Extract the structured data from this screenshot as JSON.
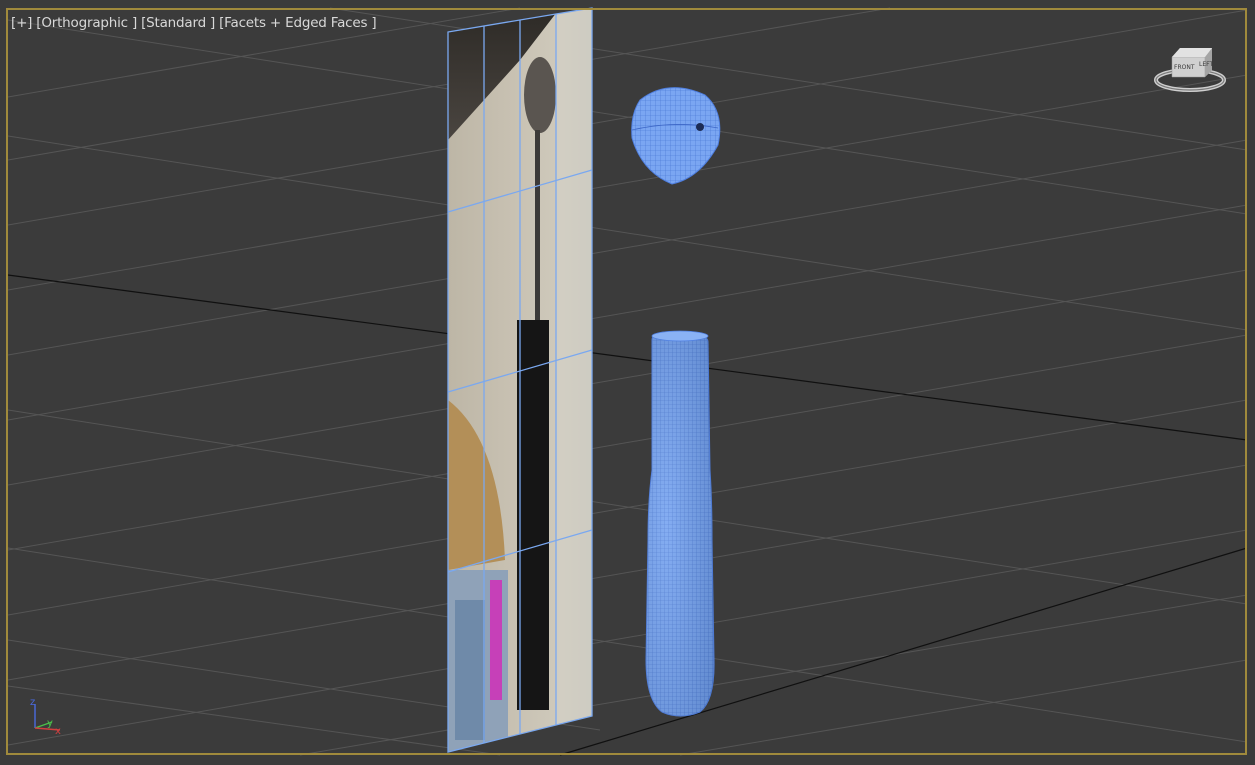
{
  "viewport": {
    "label_plus": "[+]",
    "label_view": "[Orthographic ]",
    "label_shading_mode": "[Standard ]",
    "label_display": "[Facets + Edged Faces ]",
    "active_border_color": "#a08a3c",
    "background_color": "#3b3b3b"
  },
  "viewcube": {
    "face_label": "FRONT",
    "side_label": "LEFT"
  },
  "axis_tripod": {
    "z_label": "z",
    "y_label": "y",
    "x_label": "x",
    "z_color": "#4a6adf",
    "y_color": "#4ac04a",
    "x_color": "#d04040"
  },
  "scene_objects": [
    {
      "name": "textured-plane",
      "type": "plane",
      "selected": true
    },
    {
      "name": "lamp-shade",
      "type": "hemisphere",
      "color": "#6f9ff0"
    },
    {
      "name": "lamp-stem",
      "type": "cylinder",
      "color": "#6f9ff0"
    }
  ]
}
